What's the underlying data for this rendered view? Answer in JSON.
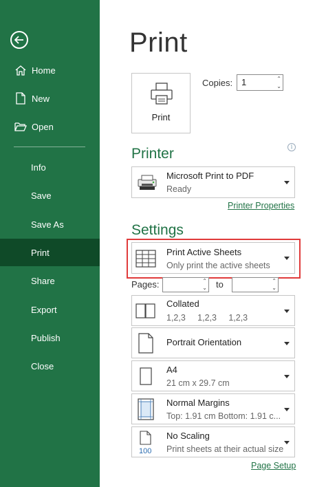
{
  "sidebar": {
    "items": [
      {
        "label": "Home",
        "icon": "home-icon"
      },
      {
        "label": "New",
        "icon": "new-document-icon"
      },
      {
        "label": "Open",
        "icon": "folder-open-icon"
      },
      {
        "label": "Info"
      },
      {
        "label": "Save"
      },
      {
        "label": "Save As"
      },
      {
        "label": "Print",
        "active": true
      },
      {
        "label": "Share"
      },
      {
        "label": "Export"
      },
      {
        "label": "Publish"
      },
      {
        "label": "Close"
      }
    ]
  },
  "main": {
    "title": "Print",
    "print_button_label": "Print",
    "copies_label": "Copies:",
    "copies_value": "1",
    "printer": {
      "heading": "Printer",
      "name": "Microsoft Print to PDF",
      "status": "Ready",
      "properties_link": "Printer Properties"
    },
    "settings": {
      "heading": "Settings",
      "scope": {
        "title": "Print Active Sheets",
        "subtitle": "Only print the active sheets"
      },
      "pages_label": "Pages:",
      "pages_from": "",
      "to_label": "to",
      "pages_to": "",
      "collation": {
        "title": "Collated",
        "subtitle": "1,2,3     1,2,3     1,2,3"
      },
      "orientation": {
        "title": "Portrait Orientation"
      },
      "paper": {
        "title": "A4",
        "subtitle": "21 cm x 29.7 cm"
      },
      "margins": {
        "title": "Normal Margins",
        "subtitle": "Top: 1.91 cm Bottom: 1.91 c..."
      },
      "scaling": {
        "title": "No Scaling",
        "subtitle": "Print sheets at their actual size",
        "icon_text": "100"
      },
      "page_setup_link": "Page Setup"
    }
  },
  "colors": {
    "sidebar": "#217346",
    "sidebar_active": "#0f4a28",
    "accent": "#217346",
    "highlight": "#e03a3a"
  }
}
